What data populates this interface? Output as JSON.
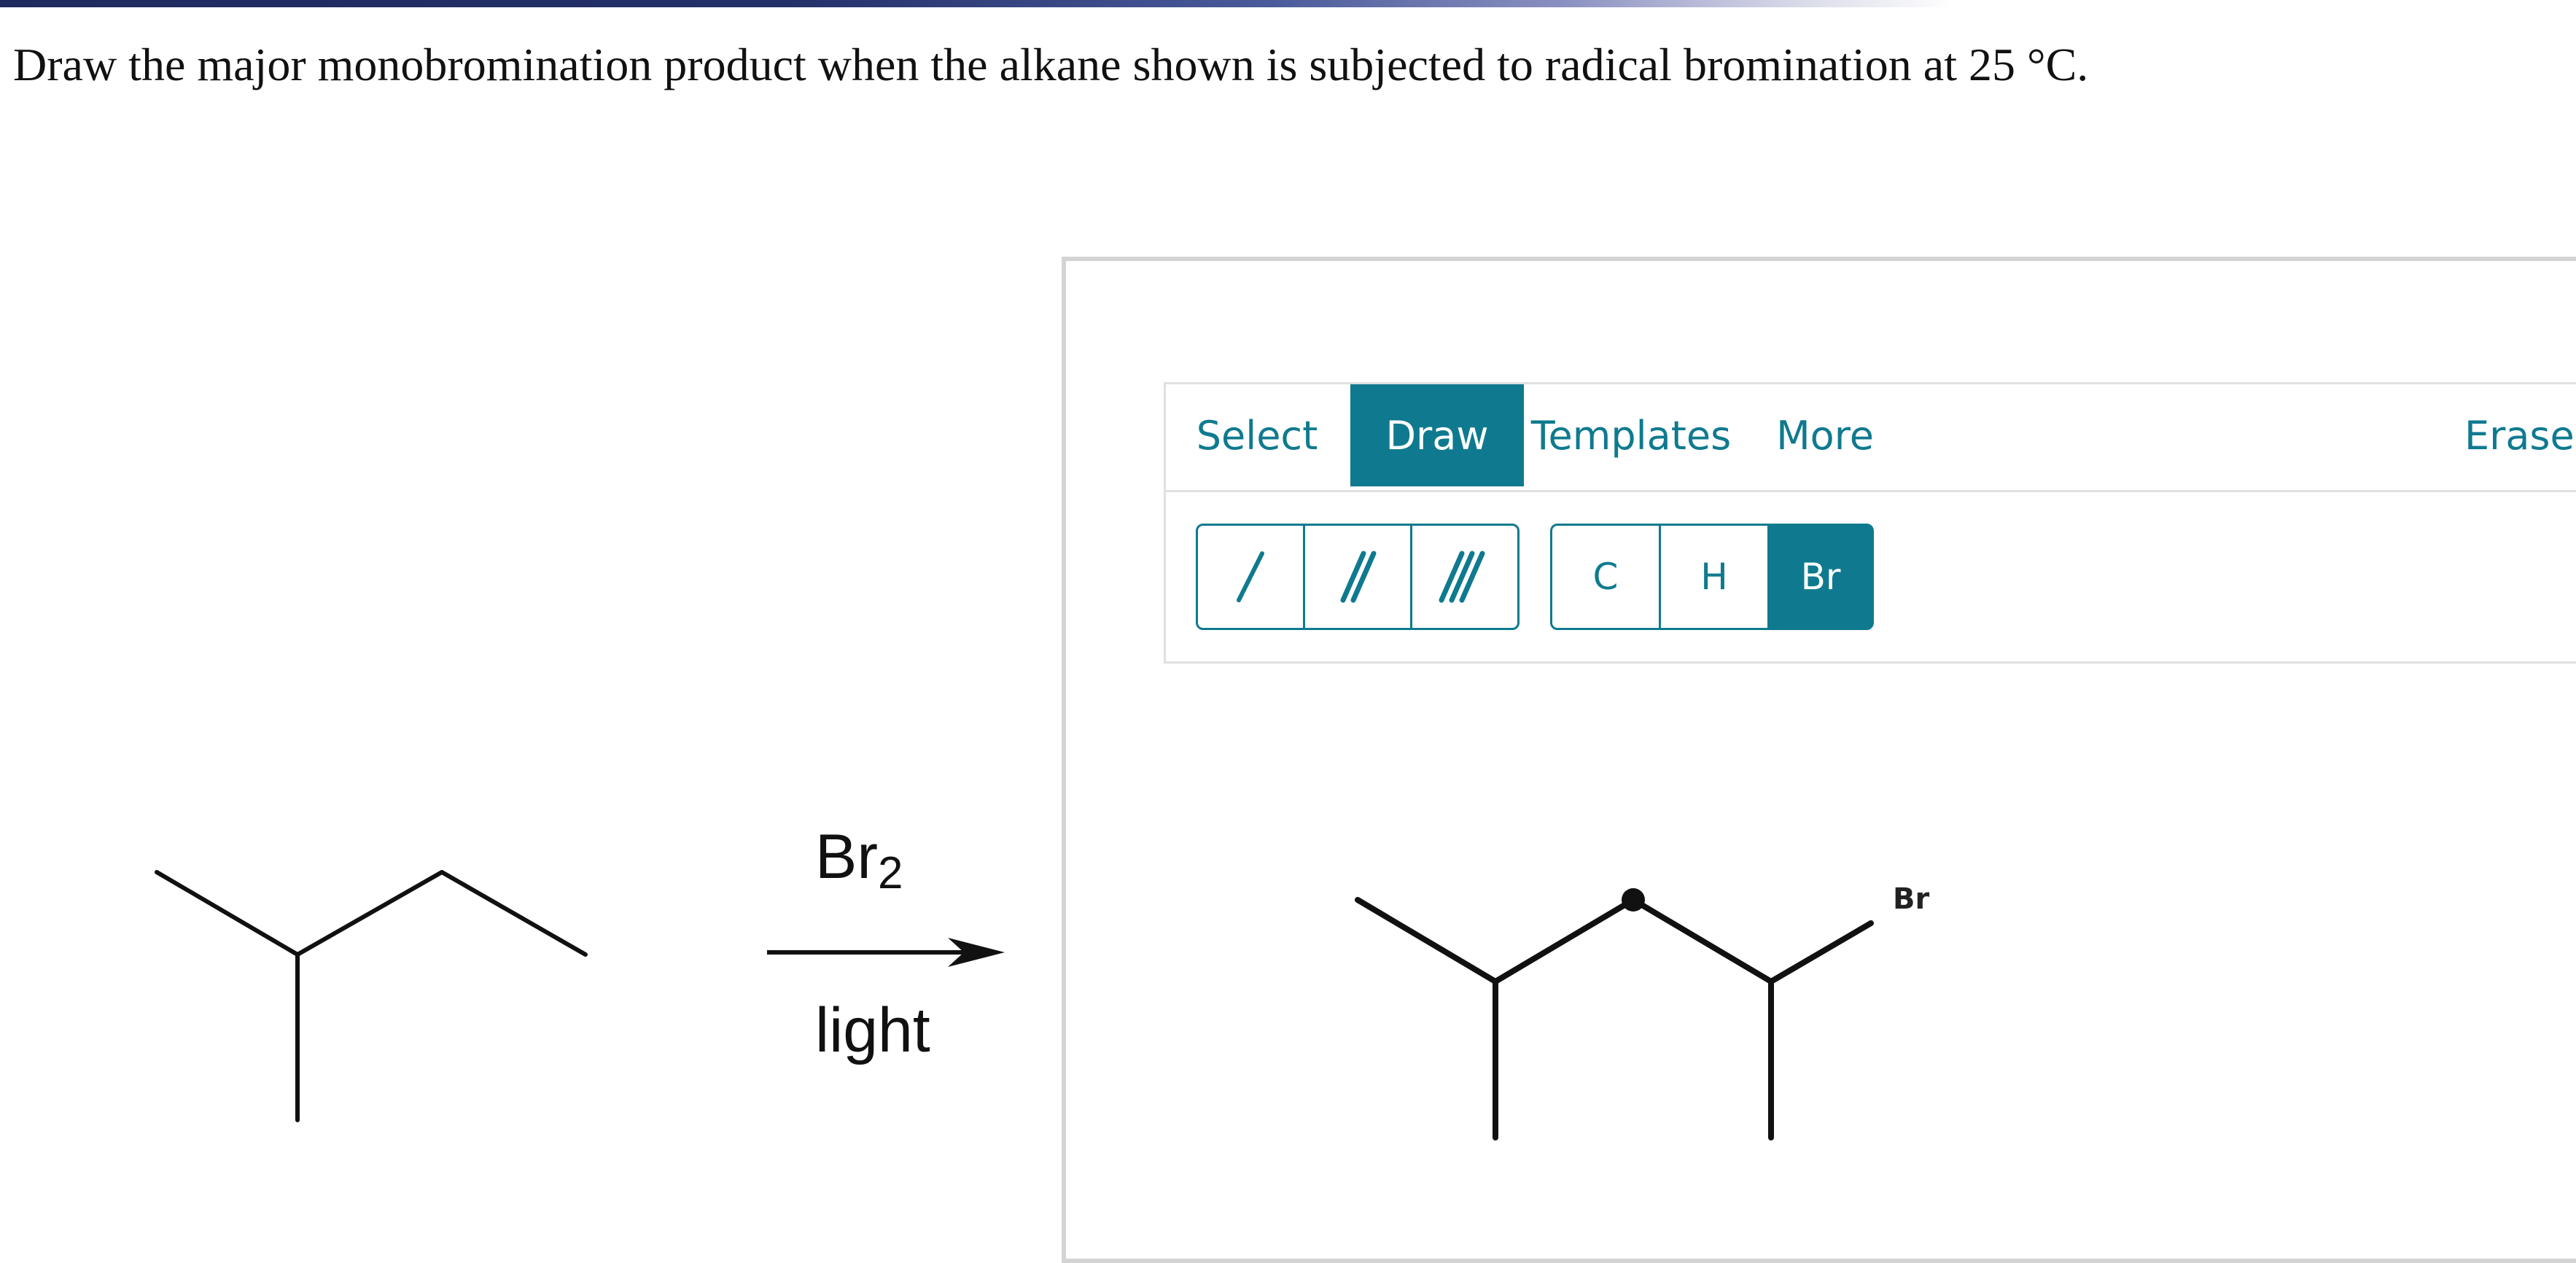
{
  "question": {
    "text": "Draw the major monobromination product when the alkane shown is subjected to radical bromination at 25 °C."
  },
  "reaction": {
    "reagent_main": "Br",
    "reagent_subscript": "2",
    "condition": "light"
  },
  "editor": {
    "tabs": [
      {
        "label": "Select",
        "active": false
      },
      {
        "label": "Draw",
        "active": true
      },
      {
        "label": "Templates",
        "active": false
      },
      {
        "label": "More",
        "active": false
      }
    ],
    "erase_label": "Erase",
    "bond_tools": [
      {
        "icon": "single-bond-icon"
      },
      {
        "icon": "double-bond-icon"
      },
      {
        "icon": "triple-bond-icon"
      }
    ],
    "atom_tools": [
      {
        "label": "C",
        "active": false
      },
      {
        "label": "H",
        "active": false
      },
      {
        "label": "Br",
        "active": true
      }
    ],
    "canvas_atom_label": "Br"
  },
  "colors": {
    "accent": "#0f7a8f",
    "text": "#111111",
    "border": "#d4d4d4"
  }
}
